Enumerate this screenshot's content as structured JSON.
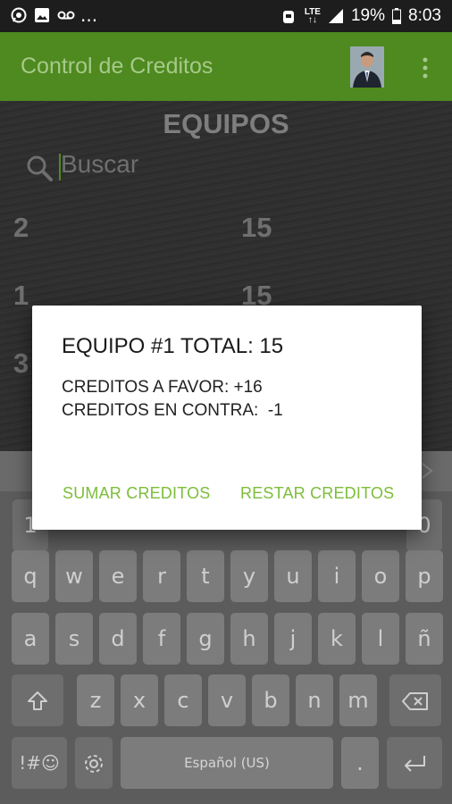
{
  "status_bar": {
    "network": "LTE",
    "battery": "19%",
    "time": "8:03",
    "overflow": "..."
  },
  "app_bar": {
    "title": "Control de Creditos"
  },
  "screen": {
    "heading": "EQUIPOS",
    "search_placeholder": "Buscar",
    "rows": [
      {
        "team": "2",
        "credits": "15"
      },
      {
        "team": "1",
        "credits": "15"
      },
      {
        "team": "3",
        "credits": ""
      }
    ]
  },
  "dialog": {
    "title": "EQUIPO #1 TOTAL: 15",
    "line1": "CREDITOS A FAVOR: +16",
    "line2": "CREDITOS EN CONTRA:  -1",
    "btn_add": "SUMAR CREDITOS",
    "btn_sub": "RESTAR CREDITOS"
  },
  "keyboard": {
    "row1": [
      "q",
      "w",
      "e",
      "r",
      "t",
      "y",
      "u",
      "i",
      "o",
      "p"
    ],
    "row2": [
      "a",
      "s",
      "d",
      "f",
      "g",
      "h",
      "j",
      "k",
      "l",
      "ñ"
    ],
    "row3": [
      "z",
      "x",
      "c",
      "v",
      "b",
      "n",
      "m"
    ],
    "number_first": "1",
    "number_last": "0",
    "symbols": "!#☺",
    "space_label": "Español (US)",
    "period": "."
  },
  "colors": {
    "app_bar": "#4e8a1f",
    "accent": "#7cbd3a"
  }
}
